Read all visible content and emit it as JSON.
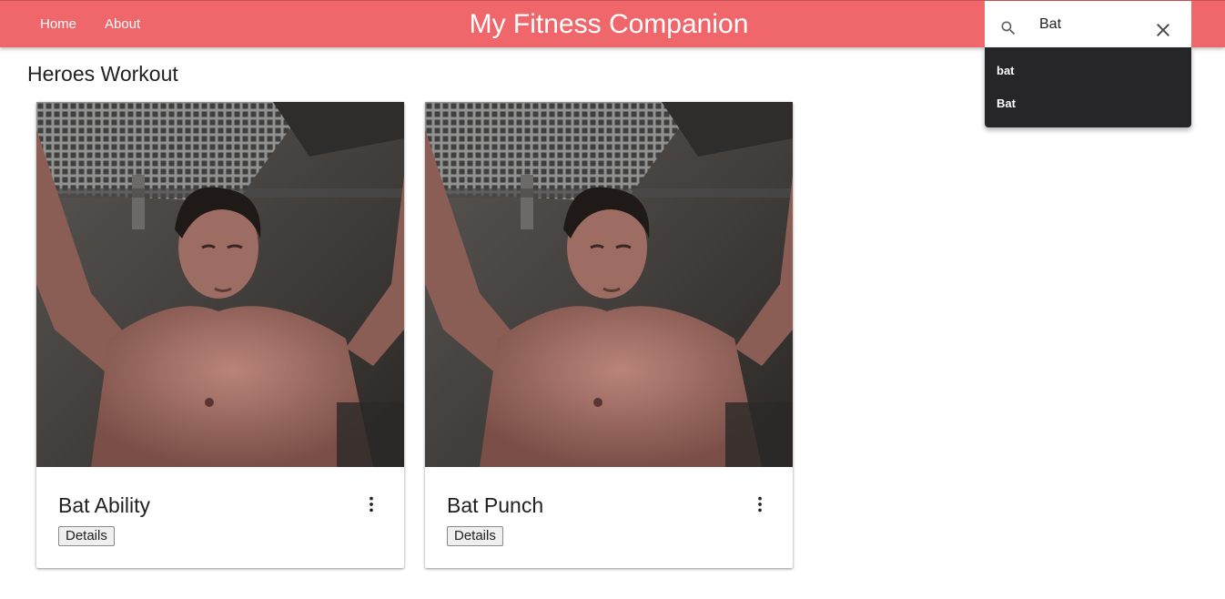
{
  "nav": {
    "home": "Home",
    "about": "About"
  },
  "app": {
    "title": "My Fitness Companion"
  },
  "search": {
    "value": "Bat",
    "suggestions": [
      "bat",
      "Bat"
    ]
  },
  "page": {
    "title": "Heroes Workout"
  },
  "cards": [
    {
      "title": "Bat Ability",
      "details_label": "Details",
      "image": "hero-workout-photo"
    },
    {
      "title": "Bat Punch",
      "details_label": "Details",
      "image": "hero-workout-photo"
    }
  ],
  "colors": {
    "accent": "#f0676b",
    "suggestions_bg": "#262628"
  },
  "icons": {
    "search": "search-icon",
    "clear": "close-icon",
    "more": "more-vert-icon"
  }
}
